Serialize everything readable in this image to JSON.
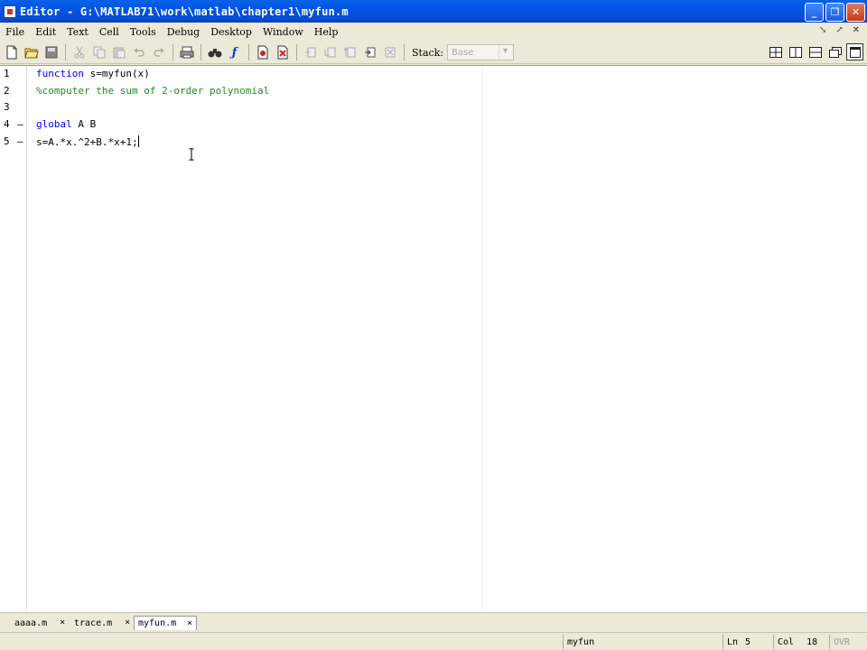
{
  "window": {
    "title": "Editor - G:\\MATLAB71\\work\\matlab\\chapter1\\myfun.m",
    "minimize": "_",
    "maximize": "❐",
    "close": "✕"
  },
  "menu": {
    "items": [
      "File",
      "Edit",
      "Text",
      "Cell",
      "Tools",
      "Debug",
      "Desktop",
      "Window",
      "Help"
    ],
    "undock_icons": [
      "↘",
      "↗",
      "✕"
    ]
  },
  "toolbar": {
    "stack_label": "Stack:",
    "stack_value": "Base"
  },
  "editor": {
    "lines": [
      {
        "num": "1",
        "dash": "",
        "parts": [
          {
            "t": "function",
            "c": "kw"
          },
          {
            "t": " s=myfun(x)",
            "c": ""
          }
        ]
      },
      {
        "num": "2",
        "dash": "",
        "parts": [
          {
            "t": "%computer the sum of 2-order polynomial",
            "c": "cm"
          }
        ]
      },
      {
        "num": "3",
        "dash": "",
        "parts": []
      },
      {
        "num": "4",
        "dash": "–",
        "parts": [
          {
            "t": "global",
            "c": "kw"
          },
          {
            "t": " A B",
            "c": ""
          }
        ]
      },
      {
        "num": "5",
        "dash": "–",
        "parts": [
          {
            "t": "s=A.*x.^2+B.*x+1;",
            "c": ""
          }
        ]
      }
    ]
  },
  "tabs": [
    {
      "name": "aaaa.m",
      "close": "×"
    },
    {
      "name": "trace.m",
      "close": "×"
    },
    {
      "name": "myfun.m",
      "close": "×"
    }
  ],
  "status": {
    "function_name": "myfun",
    "ln_label": "Ln",
    "ln_value": "5",
    "col_label": "Col",
    "col_value": "18",
    "ovr": "OVR"
  },
  "colors": {
    "keyword": "#0000ff",
    "comment": "#228b22",
    "titlebar": "#0054e3"
  }
}
